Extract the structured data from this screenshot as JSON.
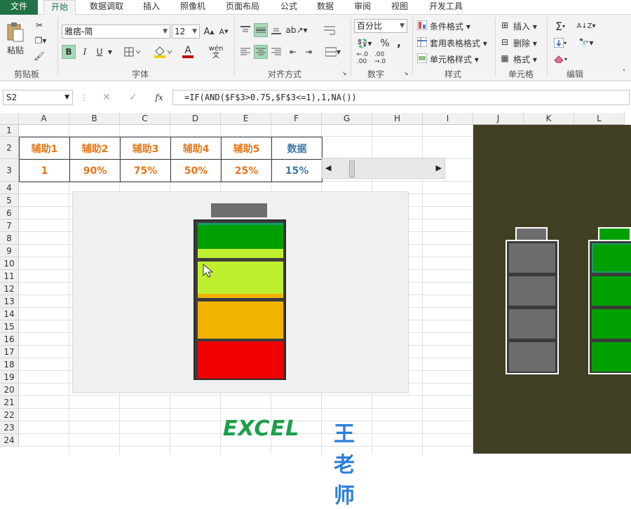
{
  "ribbon_tabs": [
    "文件",
    "开始",
    "数据调取",
    "插入",
    "照像机",
    "页面布局",
    "公式",
    "数据",
    "审阅",
    "视图",
    "开发工具"
  ],
  "ribbon": {
    "clipboard": {
      "paste_label": "粘贴",
      "group_label": "剪贴板"
    },
    "font": {
      "font_name": "雅痞-简",
      "font_size": "12",
      "group_label": "字体",
      "bold": "B",
      "italic": "I",
      "underline": "U",
      "font_color_letter": "A",
      "phonetic_label": "wén"
    },
    "alignment": {
      "group_label": "对齐方式"
    },
    "number": {
      "format": "百分比",
      "group_label": "数字",
      "percent": "%",
      "comma": ","
    },
    "styles": {
      "items": [
        "条件格式",
        "套用表格格式",
        "单元格样式"
      ],
      "group_label": "样式"
    },
    "cells": {
      "items": [
        "插入",
        "删除",
        "格式"
      ],
      "group_label": "单元格"
    },
    "editing": {
      "group_label": "编辑"
    }
  },
  "formula_bar": {
    "name_box": "S2",
    "formula": "=IF(AND($F$3>0.75,$F$3<=1),1,NA())",
    "fx": "fx"
  },
  "columns": [
    "A",
    "B",
    "C",
    "D",
    "E",
    "F",
    "G",
    "H",
    "I",
    "J",
    "K",
    "L"
  ],
  "rows": [
    "1",
    "2",
    "3",
    "4",
    "5",
    "6",
    "7",
    "8",
    "9",
    "10",
    "11",
    "12",
    "13",
    "14",
    "15",
    "16",
    "17",
    "18",
    "19",
    "20",
    "21",
    "22",
    "23",
    "24"
  ],
  "table": {
    "headers": [
      "辅助1",
      "辅助2",
      "辅助3",
      "辅助4",
      "辅助5",
      "数据"
    ],
    "values": [
      "1",
      "90%",
      "75%",
      "50%",
      "25%",
      "15%"
    ]
  },
  "scrollbar": {
    "value_fraction": 0.15
  },
  "battery_segments": [
    {
      "color": "#00a000",
      "top_color": "#00a000",
      "bottom_color": "#bff030"
    },
    {
      "color": "#bff030",
      "bottom_color": "#f0b400"
    },
    {
      "color": "#f0b400"
    },
    {
      "color": "#f00000"
    }
  ],
  "watermark": {
    "left": "EXCEL",
    "right": "王老师"
  },
  "colors": {
    "excel_green": "#217346",
    "panel_bg": "#413f23",
    "header_orange": "#e4771a",
    "header_blue": "#3d78a8"
  }
}
